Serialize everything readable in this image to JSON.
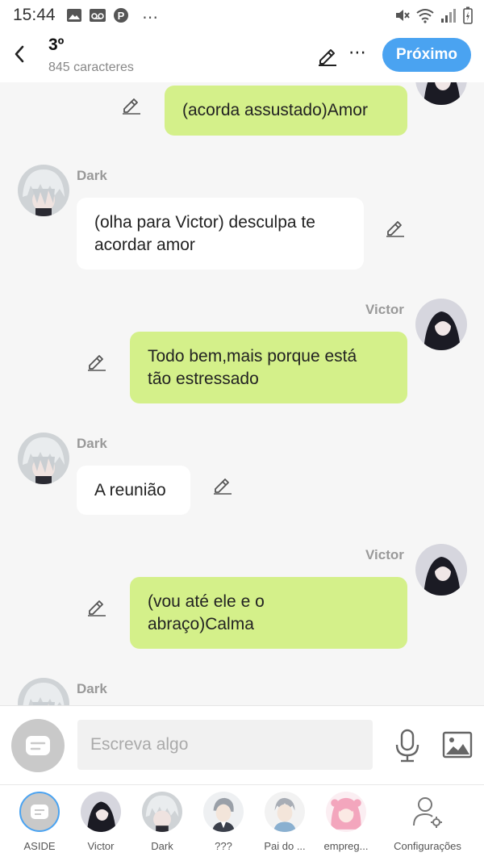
{
  "status_bar": {
    "time": "15:44",
    "dots": "⋯"
  },
  "header": {
    "title": "3º",
    "subtitle": "845 caracteres",
    "more": "⋯",
    "next_label": "Próximo"
  },
  "messages": [
    {
      "side": "right",
      "text": "(acorda assustado)Amor"
    },
    {
      "side": "left",
      "name": "Dark",
      "text_lines": [
        "(olha para Victor) desculpa te",
        "acordar amor"
      ]
    },
    {
      "side": "right",
      "name": "Victor",
      "text_lines": [
        "Todo bem,mais porque está",
        "tão estressado"
      ]
    },
    {
      "side": "left",
      "name": "Dark",
      "text": "A reunião"
    },
    {
      "side": "right",
      "name": "Victor",
      "text_lines": [
        "(vou até ele e o",
        "abraço)Calma"
      ]
    },
    {
      "side": "left",
      "name": "Dark"
    }
  ],
  "composer": {
    "placeholder": "Escreva algo"
  },
  "characters": [
    {
      "label": "ASIDE"
    },
    {
      "label": "Victor"
    },
    {
      "label": "Dark"
    },
    {
      "label": "???"
    },
    {
      "label": "Pai do ..."
    },
    {
      "label": "empreg..."
    },
    {
      "label": "Configurações"
    }
  ],
  "colors": {
    "accent": "#4aa3f1",
    "green_bubble": "#d4f08a",
    "white_bubble": "#ffffff",
    "background": "#f6f6f6"
  }
}
